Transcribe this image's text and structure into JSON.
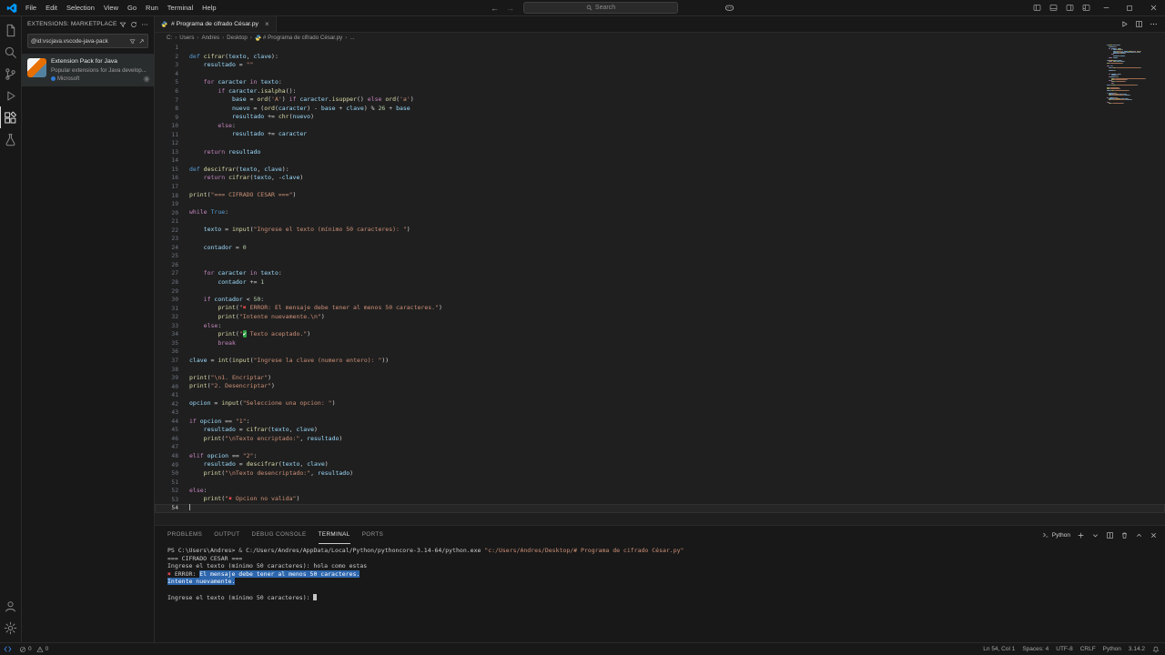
{
  "title_bar": {
    "menus": [
      "File",
      "Edit",
      "Selection",
      "View",
      "Go",
      "Run",
      "Terminal",
      "Help"
    ],
    "search_label": "Search"
  },
  "activity_bar": {
    "top": [
      "explorer",
      "search",
      "source-control",
      "run-and-debug",
      "extensions",
      "testing"
    ],
    "active": "extensions",
    "bottom": [
      "account",
      "settings"
    ]
  },
  "sidebar": {
    "header": "EXTENSIONS: MARKETPLACE",
    "search_value": "@id:vscjava.vscode-java-pack",
    "extension": {
      "name": "Extension Pack for Java",
      "description": "Popular extensions for Java develop...",
      "publisher": "Microsoft"
    }
  },
  "editor": {
    "tab_label": "# Programa de cifrado César.py",
    "breadcrumb": [
      "C:",
      "Users",
      "Andres",
      "Desktop",
      "# Programa de cifrado César.py",
      "..."
    ],
    "active_line": 54,
    "lines": [
      [],
      [
        [
          "k",
          "def "
        ],
        [
          "f",
          "cifrar"
        ],
        [
          "p",
          "("
        ],
        [
          "v",
          "texto"
        ],
        [
          "p",
          ", "
        ],
        [
          "v",
          "clave"
        ],
        [
          "p",
          "):"
        ]
      ],
      [
        [
          "p",
          "    "
        ],
        [
          "v",
          "resultado"
        ],
        [
          "p",
          " = "
        ],
        [
          "s",
          "\"\""
        ]
      ],
      [],
      [
        [
          "p",
          "    "
        ],
        [
          "c",
          "for"
        ],
        [
          "p",
          " "
        ],
        [
          "v",
          "caracter"
        ],
        [
          "p",
          " "
        ],
        [
          "c",
          "in"
        ],
        [
          "p",
          " "
        ],
        [
          "v",
          "texto"
        ],
        [
          "p",
          ":"
        ]
      ],
      [
        [
          "p",
          "        "
        ],
        [
          "c",
          "if"
        ],
        [
          "p",
          " "
        ],
        [
          "v",
          "caracter"
        ],
        [
          "p",
          "."
        ],
        [
          "f",
          "isalpha"
        ],
        [
          "p",
          "():"
        ]
      ],
      [
        [
          "p",
          "            "
        ],
        [
          "v",
          "base"
        ],
        [
          "p",
          " = "
        ],
        [
          "f",
          "ord"
        ],
        [
          "p",
          "("
        ],
        [
          "s",
          "'A'"
        ],
        [
          "p",
          ") "
        ],
        [
          "c",
          "if"
        ],
        [
          "p",
          " "
        ],
        [
          "v",
          "caracter"
        ],
        [
          "p",
          "."
        ],
        [
          "f",
          "isupper"
        ],
        [
          "p",
          "() "
        ],
        [
          "c",
          "else"
        ],
        [
          "p",
          " "
        ],
        [
          "f",
          "ord"
        ],
        [
          "p",
          "("
        ],
        [
          "s",
          "'a'"
        ],
        [
          "p",
          ")"
        ]
      ],
      [
        [
          "p",
          "            "
        ],
        [
          "v",
          "nuevo"
        ],
        [
          "p",
          " = ("
        ],
        [
          "f",
          "ord"
        ],
        [
          "p",
          "("
        ],
        [
          "v",
          "caracter"
        ],
        [
          "p",
          ") - "
        ],
        [
          "v",
          "base"
        ],
        [
          "p",
          " + "
        ],
        [
          "v",
          "clave"
        ],
        [
          "p",
          ") % "
        ],
        [
          "n",
          "26"
        ],
        [
          "p",
          " + "
        ],
        [
          "v",
          "base"
        ]
      ],
      [
        [
          "p",
          "            "
        ],
        [
          "v",
          "resultado"
        ],
        [
          "p",
          " += "
        ],
        [
          "f",
          "chr"
        ],
        [
          "p",
          "("
        ],
        [
          "v",
          "nuevo"
        ],
        [
          "p",
          ")"
        ]
      ],
      [
        [
          "p",
          "        "
        ],
        [
          "c",
          "else"
        ],
        [
          "p",
          ":"
        ]
      ],
      [
        [
          "p",
          "            "
        ],
        [
          "v",
          "resultado"
        ],
        [
          "p",
          " += "
        ],
        [
          "v",
          "caracter"
        ]
      ],
      [],
      [
        [
          "p",
          "    "
        ],
        [
          "c",
          "return"
        ],
        [
          "p",
          " "
        ],
        [
          "v",
          "resultado"
        ]
      ],
      [],
      [
        [
          "k",
          "def "
        ],
        [
          "f",
          "descifrar"
        ],
        [
          "p",
          "("
        ],
        [
          "v",
          "texto"
        ],
        [
          "p",
          ", "
        ],
        [
          "v",
          "clave"
        ],
        [
          "p",
          "):"
        ]
      ],
      [
        [
          "p",
          "    "
        ],
        [
          "c",
          "return"
        ],
        [
          "p",
          " "
        ],
        [
          "f",
          "cifrar"
        ],
        [
          "p",
          "("
        ],
        [
          "v",
          "texto"
        ],
        [
          "p",
          ", -"
        ],
        [
          "v",
          "clave"
        ],
        [
          "p",
          ")"
        ]
      ],
      [],
      [
        [
          "f",
          "print"
        ],
        [
          "p",
          "("
        ],
        [
          "s",
          "\"=== CIFRADO CESAR ===\""
        ],
        [
          "p",
          ")"
        ]
      ],
      [],
      [
        [
          "c",
          "while"
        ],
        [
          "p",
          " "
        ],
        [
          "k",
          "True"
        ],
        [
          "p",
          ":"
        ]
      ],
      [],
      [
        [
          "p",
          "    "
        ],
        [
          "v",
          "texto"
        ],
        [
          "p",
          " = "
        ],
        [
          "f",
          "input"
        ],
        [
          "p",
          "("
        ],
        [
          "s",
          "\"Ingrese el texto (mínimo 50 caracteres): \""
        ],
        [
          "p",
          ")"
        ]
      ],
      [],
      [
        [
          "p",
          "    "
        ],
        [
          "v",
          "contador"
        ],
        [
          "p",
          " = "
        ],
        [
          "n",
          "0"
        ]
      ],
      [],
      [],
      [
        [
          "p",
          "    "
        ],
        [
          "c",
          "for"
        ],
        [
          "p",
          " "
        ],
        [
          "v",
          "caracter"
        ],
        [
          "p",
          " "
        ],
        [
          "c",
          "in"
        ],
        [
          "p",
          " "
        ],
        [
          "v",
          "texto"
        ],
        [
          "p",
          ":"
        ]
      ],
      [
        [
          "p",
          "        "
        ],
        [
          "v",
          "contador"
        ],
        [
          "p",
          " += "
        ],
        [
          "n",
          "1"
        ]
      ],
      [],
      [
        [
          "p",
          "    "
        ],
        [
          "c",
          "if"
        ],
        [
          "p",
          " "
        ],
        [
          "v",
          "contador"
        ],
        [
          "p",
          " < "
        ],
        [
          "n",
          "50"
        ],
        [
          "p",
          ":"
        ]
      ],
      [
        [
          "p",
          "        "
        ],
        [
          "f",
          "print"
        ],
        [
          "p",
          "("
        ],
        [
          "s",
          "\""
        ],
        [
          "x",
          "✖"
        ],
        [
          "s",
          " ERROR: El mensaje debe tener al menos 50 caracteres.\""
        ],
        [
          "p",
          ")"
        ]
      ],
      [
        [
          "p",
          "        "
        ],
        [
          "f",
          "print"
        ],
        [
          "p",
          "("
        ],
        [
          "s",
          "\"Intente nuevamente.\\n\""
        ],
        [
          "p",
          ")"
        ]
      ],
      [
        [
          "p",
          "    "
        ],
        [
          "c",
          "else"
        ],
        [
          "p",
          ":"
        ]
      ],
      [
        [
          "p",
          "        "
        ],
        [
          "f",
          "print"
        ],
        [
          "p",
          "("
        ],
        [
          "s",
          "\""
        ],
        [
          "ck",
          "✔"
        ],
        [
          "s",
          " Texto aceptado.\""
        ],
        [
          "p",
          ")"
        ]
      ],
      [
        [
          "p",
          "        "
        ],
        [
          "c",
          "break"
        ]
      ],
      [],
      [
        [
          "v",
          "clave"
        ],
        [
          "p",
          " = "
        ],
        [
          "f",
          "int"
        ],
        [
          "p",
          "("
        ],
        [
          "f",
          "input"
        ],
        [
          "p",
          "("
        ],
        [
          "s",
          "\"Ingrese la clave (numero entero): \""
        ],
        [
          "p",
          "))"
        ]
      ],
      [],
      [
        [
          "f",
          "print"
        ],
        [
          "p",
          "("
        ],
        [
          "s",
          "\"\\n1. Encriptar\""
        ],
        [
          "p",
          ")"
        ]
      ],
      [
        [
          "f",
          "print"
        ],
        [
          "p",
          "("
        ],
        [
          "s",
          "\"2. Desencriptar\""
        ],
        [
          "p",
          ")"
        ]
      ],
      [],
      [
        [
          "v",
          "opcion"
        ],
        [
          "p",
          " = "
        ],
        [
          "f",
          "input"
        ],
        [
          "p",
          "("
        ],
        [
          "s",
          "\"Seleccione una opcion: \""
        ],
        [
          "p",
          ")"
        ]
      ],
      [],
      [
        [
          "c",
          "if"
        ],
        [
          "p",
          " "
        ],
        [
          "v",
          "opcion"
        ],
        [
          "p",
          " == "
        ],
        [
          "s",
          "\"1\""
        ],
        [
          "p",
          ":"
        ]
      ],
      [
        [
          "p",
          "    "
        ],
        [
          "v",
          "resultado"
        ],
        [
          "p",
          " = "
        ],
        [
          "f",
          "cifrar"
        ],
        [
          "p",
          "("
        ],
        [
          "v",
          "texto"
        ],
        [
          "p",
          ", "
        ],
        [
          "v",
          "clave"
        ],
        [
          "p",
          ")"
        ]
      ],
      [
        [
          "p",
          "    "
        ],
        [
          "f",
          "print"
        ],
        [
          "p",
          "("
        ],
        [
          "s",
          "\"\\nTexto encriptado:\""
        ],
        [
          "p",
          ", "
        ],
        [
          "v",
          "resultado"
        ],
        [
          "p",
          ")"
        ]
      ],
      [],
      [
        [
          "c",
          "elif"
        ],
        [
          "p",
          " "
        ],
        [
          "v",
          "opcion"
        ],
        [
          "p",
          " == "
        ],
        [
          "s",
          "\"2\""
        ],
        [
          "p",
          ":"
        ]
      ],
      [
        [
          "p",
          "    "
        ],
        [
          "v",
          "resultado"
        ],
        [
          "p",
          " = "
        ],
        [
          "f",
          "descifrar"
        ],
        [
          "p",
          "("
        ],
        [
          "v",
          "texto"
        ],
        [
          "p",
          ", "
        ],
        [
          "v",
          "clave"
        ],
        [
          "p",
          ")"
        ]
      ],
      [
        [
          "p",
          "    "
        ],
        [
          "f",
          "print"
        ],
        [
          "p",
          "("
        ],
        [
          "s",
          "\"\\nTexto desencriptado:\""
        ],
        [
          "p",
          ", "
        ],
        [
          "v",
          "resultado"
        ],
        [
          "p",
          ")"
        ]
      ],
      [],
      [
        [
          "c",
          "else"
        ],
        [
          "p",
          ":"
        ]
      ],
      [
        [
          "p",
          "    "
        ],
        [
          "f",
          "print"
        ],
        [
          "p",
          "("
        ],
        [
          "s",
          "\""
        ],
        [
          "x",
          "✖"
        ],
        [
          "s",
          " Opcion no valida\""
        ],
        [
          "p",
          ")"
        ]
      ],
      []
    ]
  },
  "panel": {
    "tabs": [
      "PROBLEMS",
      "OUTPUT",
      "DEBUG CONSOLE",
      "TERMINAL",
      "PORTS"
    ],
    "active_tab": "TERMINAL",
    "terminal_profile": "Python",
    "terminal_lines": [
      [
        [
          "t",
          "PS C:\\Users\\Andres> "
        ],
        [
          "t2",
          "&"
        ],
        [
          "t",
          " C:/Users/Andres/AppData/Local/Python/pythoncore-3.14-64/python.exe "
        ],
        [
          "ts",
          "\"c:/Users/Andres/Desktop/# Programa de cifrado César.py\""
        ]
      ],
      [
        [
          "t",
          "=== CIFRADO CESAR ==="
        ]
      ],
      [
        [
          "t",
          "Ingrese el texto (mínimo 50 caracteres): hola como estas"
        ]
      ],
      [
        [
          "x",
          "✖"
        ],
        [
          "t",
          " ERROR: "
        ],
        [
          "sel",
          "El mensaje debe tener al menos 50 caracteres."
        ]
      ],
      [
        [
          "sel",
          "Intente nuevamente."
        ]
      ],
      [],
      [
        [
          "t",
          "Ingrese el texto (mínimo 50 caracteres): "
        ],
        [
          "cur",
          ""
        ]
      ]
    ]
  },
  "status_bar": {
    "errors": "0",
    "warnings": "0",
    "items_right": [
      {
        "name": "cursor-position",
        "label": "Ln 54, Col 1"
      },
      {
        "name": "indentation",
        "label": "Spaces: 4"
      },
      {
        "name": "encoding",
        "label": "UTF-8"
      },
      {
        "name": "eol",
        "label": "CRLF"
      },
      {
        "name": "language-mode",
        "label": "Python"
      },
      {
        "name": "python-version",
        "label": "3.14.2"
      }
    ]
  }
}
